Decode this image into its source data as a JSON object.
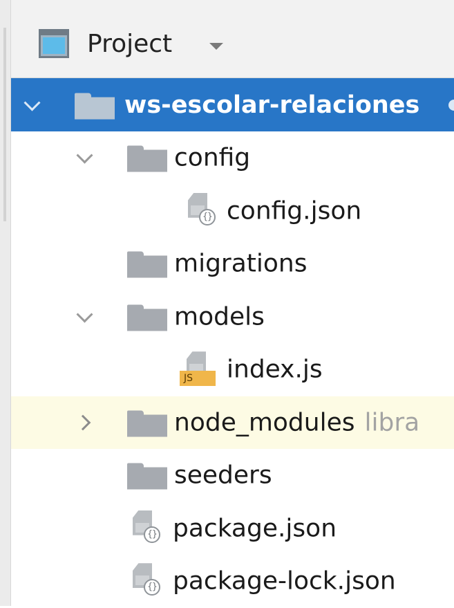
{
  "panel": {
    "title": "Project",
    "icon": "project-window-icon",
    "dropdown_icon": "caret-down-icon"
  },
  "colors": {
    "selection": "#2876c7",
    "highlight_row": "#fdfbe4",
    "folder": "#a6aab0",
    "js_badge": "#f0b64a",
    "hint_text": "#a3a3a3"
  },
  "tree": {
    "root": {
      "label": "ws-escolar-relaciones",
      "expanded": true,
      "selected": true
    },
    "config": {
      "label": "config",
      "expanded": true
    },
    "config_json": {
      "label": "config.json",
      "badge": "{}"
    },
    "migrations": {
      "label": "migrations"
    },
    "models": {
      "label": "models",
      "expanded": true
    },
    "index_js": {
      "label": "index.js",
      "badge": "JS"
    },
    "node_modules": {
      "label": "node_modules",
      "hint": "libra",
      "expanded": false
    },
    "seeders": {
      "label": "seeders"
    },
    "package_json": {
      "label": "package.json",
      "badge": "{}"
    },
    "package_lock_json": {
      "label": "package-lock.json",
      "badge": "{}"
    }
  }
}
